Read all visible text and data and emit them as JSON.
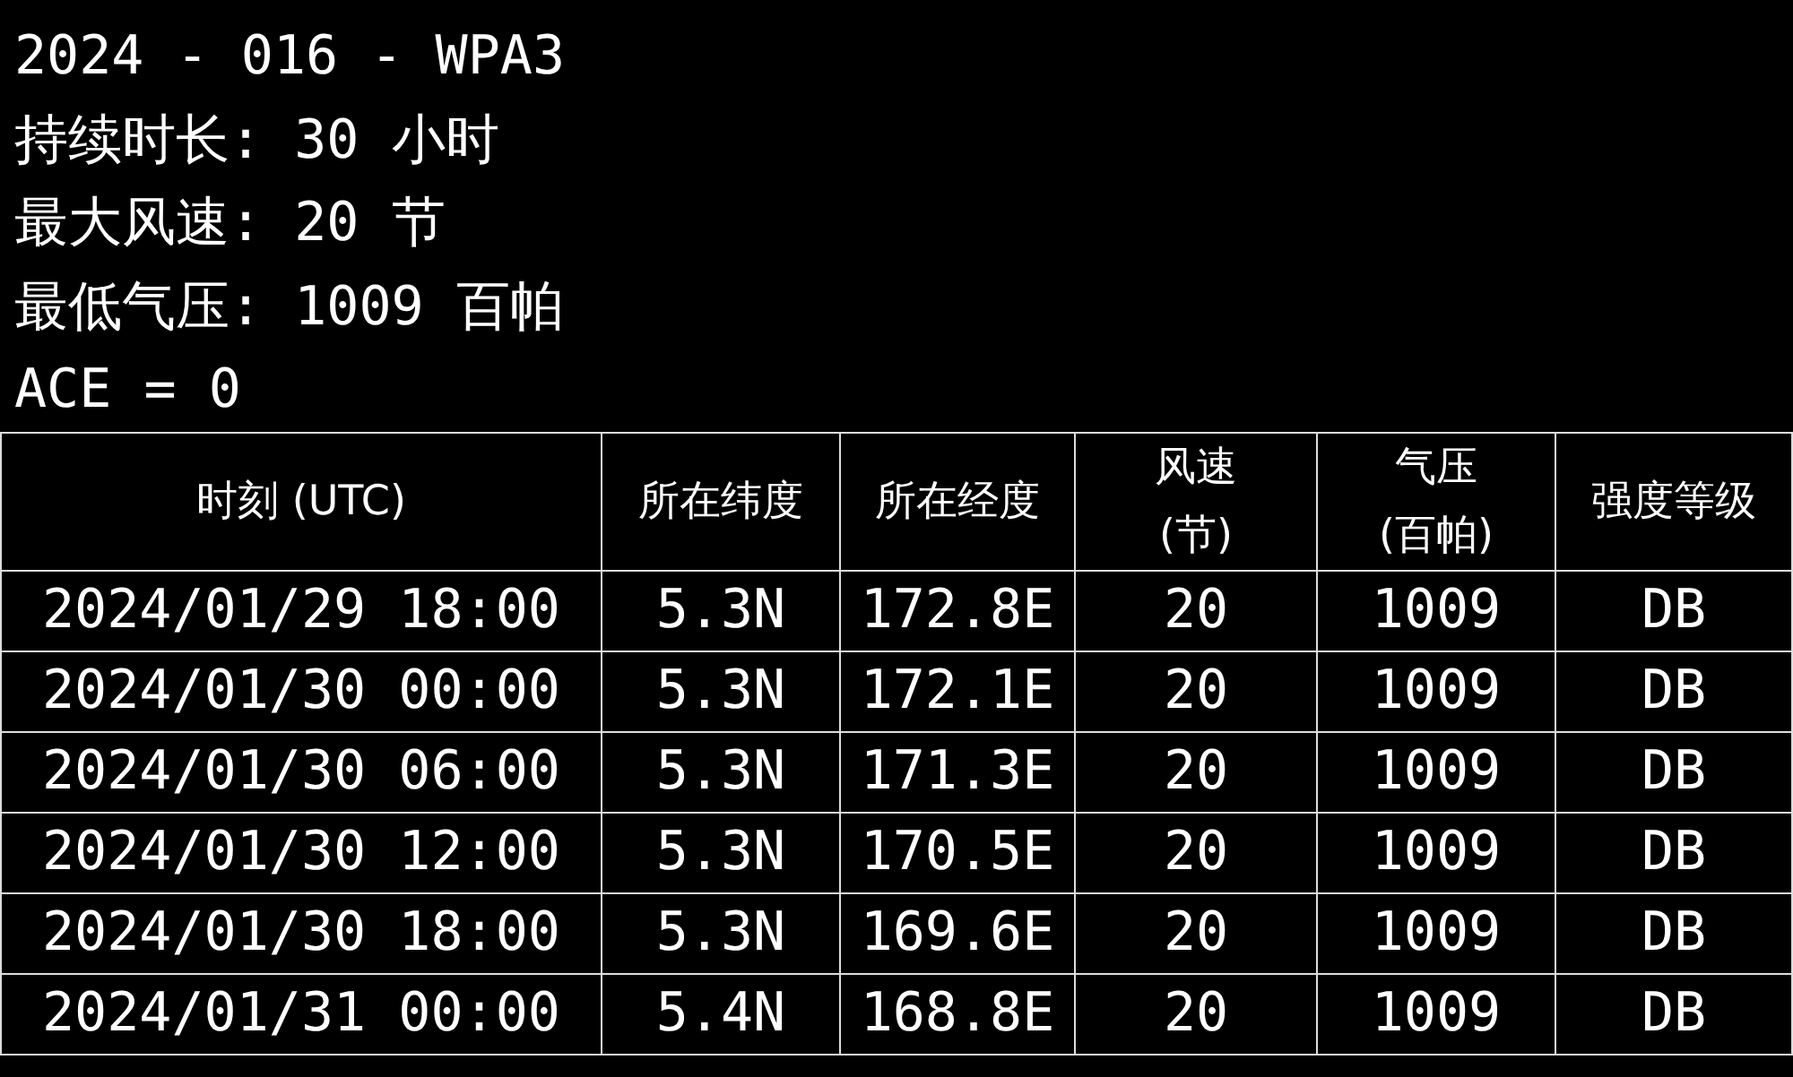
{
  "summary": [
    "2024 - 016 - WPA3",
    "持续时长: 30 小时",
    "最大风速: 20 节",
    "最低气压: 1009 百帕",
    "ACE = 0"
  ],
  "table": {
    "columns": [
      "时刻 (UTC)",
      "所在纬度",
      "所在经度",
      "风速\n(节)",
      "气压\n(百帕)",
      "强度等级"
    ],
    "rows": [
      [
        "2024/01/29 18:00",
        "5.3N",
        "172.8E",
        "20",
        "1009",
        "DB"
      ],
      [
        "2024/01/30 00:00",
        "5.3N",
        "172.1E",
        "20",
        "1009",
        "DB"
      ],
      [
        "2024/01/30 06:00",
        "5.3N",
        "171.3E",
        "20",
        "1009",
        "DB"
      ],
      [
        "2024/01/30 12:00",
        "5.3N",
        "170.5E",
        "20",
        "1009",
        "DB"
      ],
      [
        "2024/01/30 18:00",
        "5.3N",
        "169.6E",
        "20",
        "1009",
        "DB"
      ],
      [
        "2024/01/31 00:00",
        "5.4N",
        "168.8E",
        "20",
        "1009",
        "DB"
      ]
    ]
  }
}
